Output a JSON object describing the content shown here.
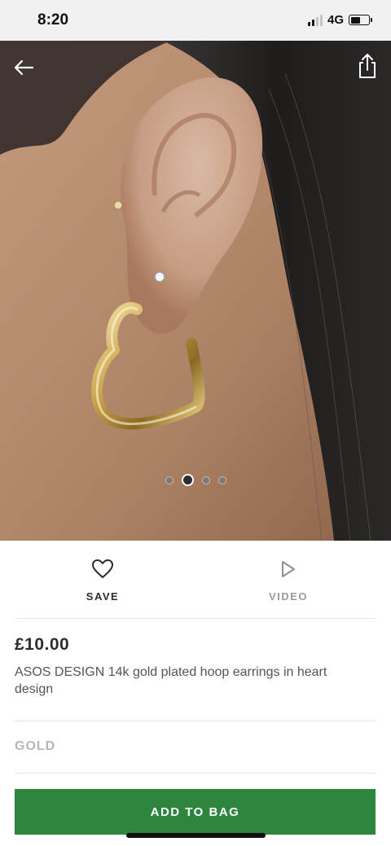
{
  "status_bar": {
    "time": "8:20",
    "network": "4G"
  },
  "product": {
    "image_alt": "Model wearing gold heart hoop earring",
    "carousel": {
      "count": 4,
      "active_index": 1
    },
    "price": "£10.00",
    "title": "ASOS DESIGN 14k gold plated hoop earrings in heart design",
    "colour": "GOLD"
  },
  "actions": {
    "save_label": "SAVE",
    "video_label": "VIDEO"
  },
  "cta": {
    "add_to_bag_label": "ADD TO BAG",
    "color": "#2e8540"
  },
  "icons": {
    "back": "back-arrow-icon",
    "share": "share-icon",
    "save": "heart-icon",
    "video": "play-icon"
  }
}
